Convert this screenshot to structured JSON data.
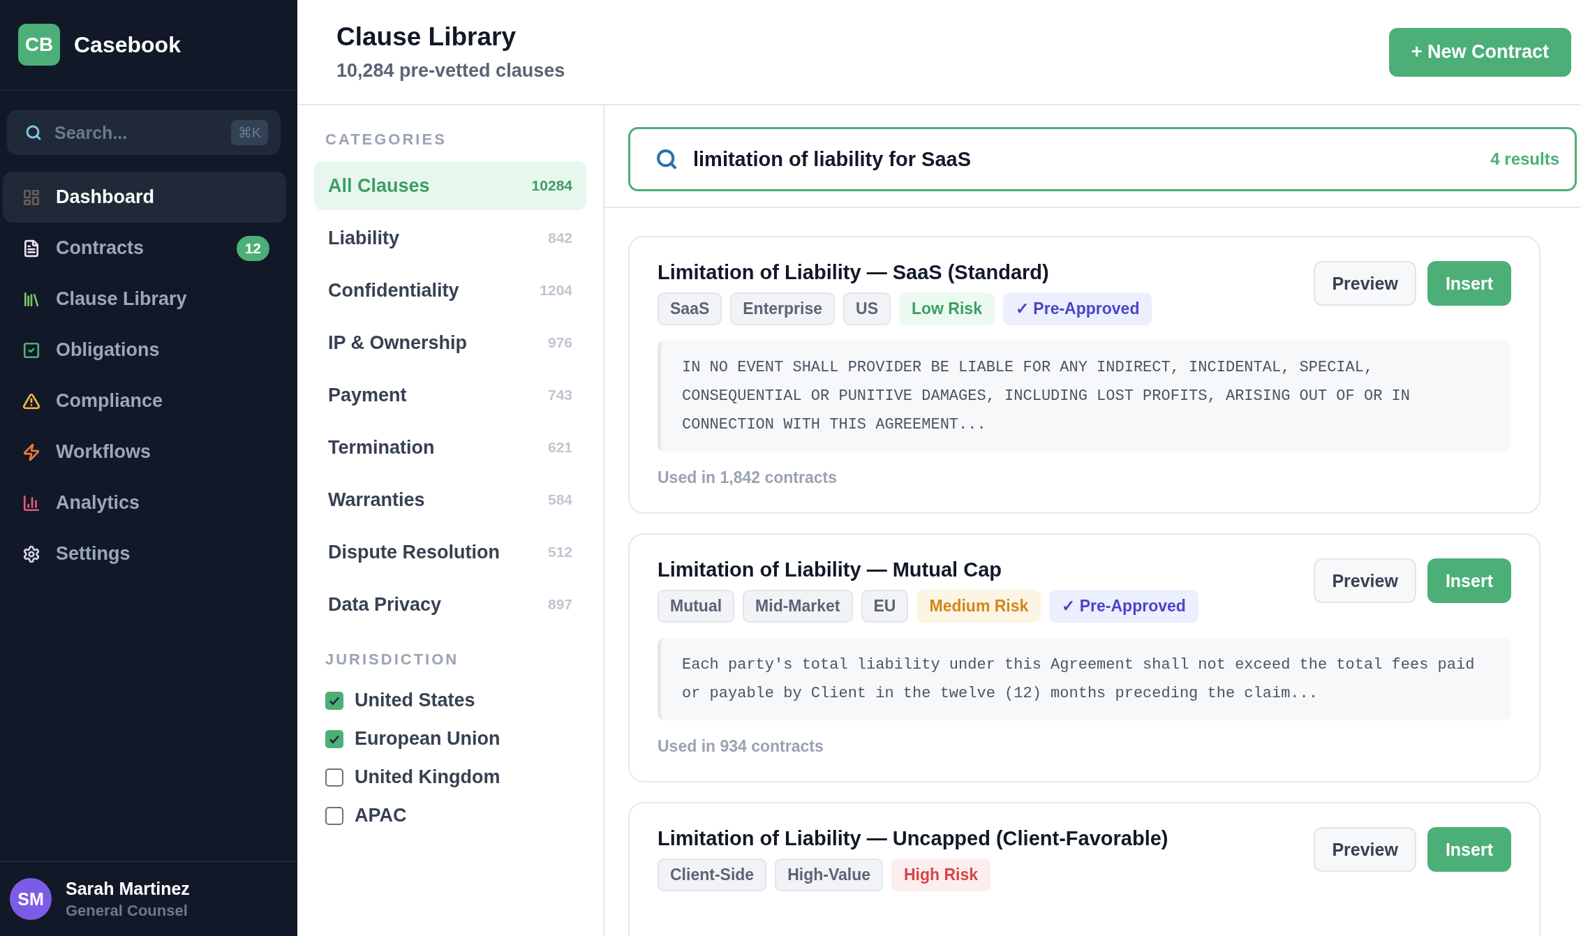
{
  "brand": {
    "logo": "CB",
    "name": "Casebook"
  },
  "sidebar": {
    "search": {
      "placeholder": "Search...",
      "shortcut": "⌘K"
    },
    "items": [
      {
        "label": "Dashboard",
        "selected": true
      },
      {
        "label": "Contracts",
        "selected": false,
        "badge": "12"
      },
      {
        "label": "Clause Library",
        "selected": false
      },
      {
        "label": "Obligations",
        "selected": false
      },
      {
        "label": "Compliance",
        "selected": false
      },
      {
        "label": "Workflows",
        "selected": false
      },
      {
        "label": "Analytics",
        "selected": false
      },
      {
        "label": "Settings",
        "selected": false
      }
    ],
    "user": {
      "initials": "SM",
      "name": "Sarah Martinez",
      "role": "General Counsel"
    }
  },
  "header": {
    "title": "Clause Library",
    "subtitle": "10,284 pre-vetted clauses",
    "action": "+ New Contract"
  },
  "categories": {
    "heading": "CATEGORIES",
    "items": [
      {
        "label": "All Clauses",
        "count": "10284",
        "selected": true
      },
      {
        "label": "Liability",
        "count": "842",
        "selected": false
      },
      {
        "label": "Confidentiality",
        "count": "1204",
        "selected": false
      },
      {
        "label": "IP & Ownership",
        "count": "976",
        "selected": false
      },
      {
        "label": "Payment",
        "count": "743",
        "selected": false
      },
      {
        "label": "Termination",
        "count": "621",
        "selected": false
      },
      {
        "label": "Warranties",
        "count": "584",
        "selected": false
      },
      {
        "label": "Dispute Resolution",
        "count": "512",
        "selected": false
      },
      {
        "label": "Data Privacy",
        "count": "897",
        "selected": false
      }
    ]
  },
  "jurisdiction": {
    "heading": "JURISDICTION",
    "items": [
      {
        "label": "United States",
        "checked": true
      },
      {
        "label": "European Union",
        "checked": true
      },
      {
        "label": "United Kingdom",
        "checked": false
      },
      {
        "label": "APAC",
        "checked": false
      }
    ]
  },
  "search": {
    "value": "limitation of liability for SaaS",
    "results": "4 results"
  },
  "clauses": [
    {
      "title": "Limitation of Liability — SaaS (Standard)",
      "tags": [
        {
          "label": "SaaS",
          "kind": "plain"
        },
        {
          "label": "Enterprise",
          "kind": "plain"
        },
        {
          "label": "US",
          "kind": "plain"
        },
        {
          "label": "Low Risk",
          "kind": "low"
        },
        {
          "label": "✓ Pre-Approved",
          "kind": "approved"
        }
      ],
      "text": "IN NO EVENT SHALL PROVIDER BE LIABLE FOR ANY INDIRECT, INCIDENTAL, SPECIAL, CONSEQUENTIAL OR PUNITIVE DAMAGES, INCLUDING LOST PROFITS, ARISING OUT OF OR IN CONNECTION WITH THIS AGREEMENT...",
      "usage": "Used in 1,842 contracts",
      "buttons": [
        "Preview",
        "Insert"
      ]
    },
    {
      "title": "Limitation of Liability — Mutual Cap",
      "tags": [
        {
          "label": "Mutual",
          "kind": "plain"
        },
        {
          "label": "Mid-Market",
          "kind": "plain"
        },
        {
          "label": "EU",
          "kind": "plain"
        },
        {
          "label": "Medium Risk",
          "kind": "medium"
        },
        {
          "label": "✓ Pre-Approved",
          "kind": "approved"
        }
      ],
      "text": "Each party's total liability under this Agreement shall not exceed the total fees paid or payable by Client in the twelve (12) months preceding the claim...",
      "usage": "Used in 934 contracts",
      "buttons": [
        "Preview",
        "Insert"
      ]
    },
    {
      "title": "Limitation of Liability — Uncapped (Client-Favorable)",
      "tags": [
        {
          "label": "Client-Side",
          "kind": "plain"
        },
        {
          "label": "High-Value",
          "kind": "plain"
        },
        {
          "label": "High Risk",
          "kind": "high"
        }
      ],
      "buttons": [
        "Preview",
        "Insert"
      ]
    }
  ]
}
